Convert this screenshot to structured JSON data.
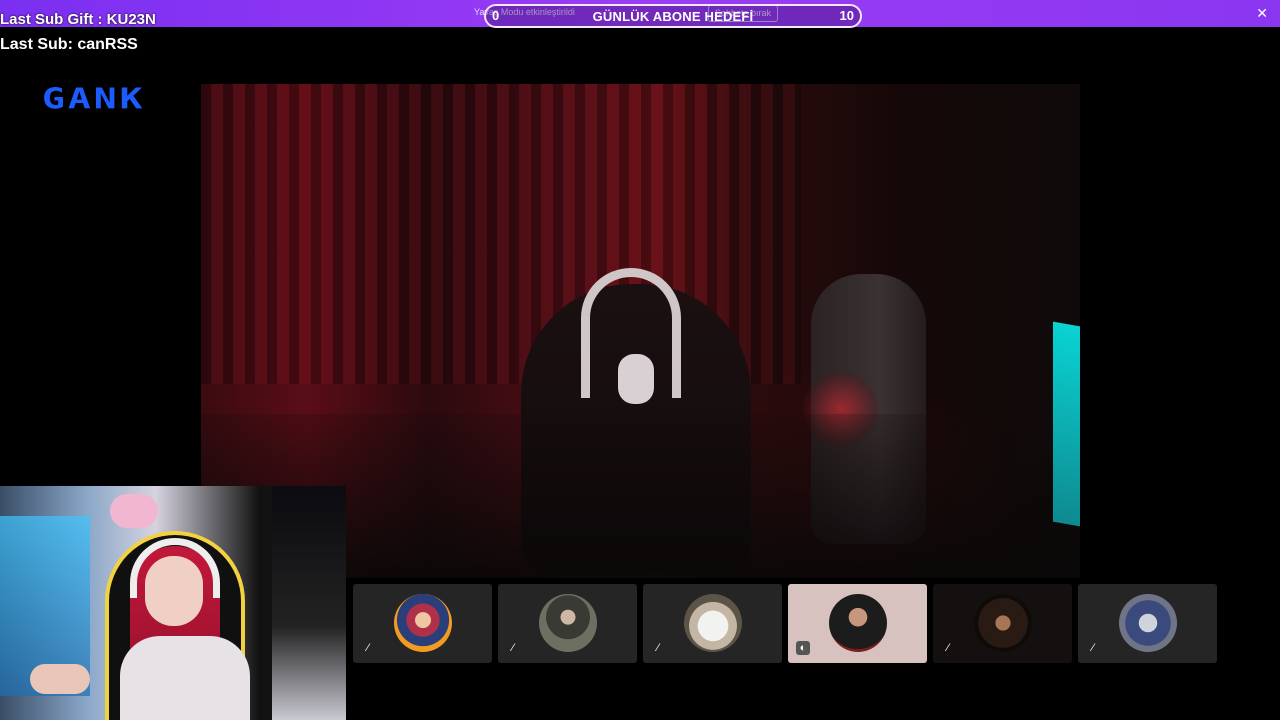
{
  "top_banner": {
    "notice_text": "Yavaş Modu etkinleştirildi",
    "notice_button": "Sohbete bırak",
    "close_icon": "close-icon"
  },
  "sub_goal": {
    "title": "GÜNLÜK ABONE HEDEFİ",
    "current": "0",
    "target": "10",
    "progress": 0
  },
  "overlay": {
    "last_sub_gift": "Last Sub Gift : KU23N",
    "last_sub": "Last Sub: canRSS",
    "logo_text": "GANK"
  },
  "participants": [
    {
      "name": "participant-1",
      "avatar": "avatar-woman-fire",
      "mic": "muted"
    },
    {
      "name": "participant-2",
      "avatar": "avatar-man-suit",
      "mic": "muted"
    },
    {
      "name": "participant-3",
      "avatar": "avatar-cat",
      "mic": "muted"
    },
    {
      "name": "participant-4",
      "avatar": "avatar-man-beard",
      "mic": "speaking",
      "active": true
    },
    {
      "name": "participant-5",
      "avatar": "avatar-dark",
      "mic": "muted"
    },
    {
      "name": "participant-6",
      "avatar": "avatar-blue-figure",
      "mic": "muted"
    }
  ],
  "colors": {
    "banner": "#8a36f0",
    "logo": "#1c5cff",
    "active_tile": "#d8c2bf"
  }
}
